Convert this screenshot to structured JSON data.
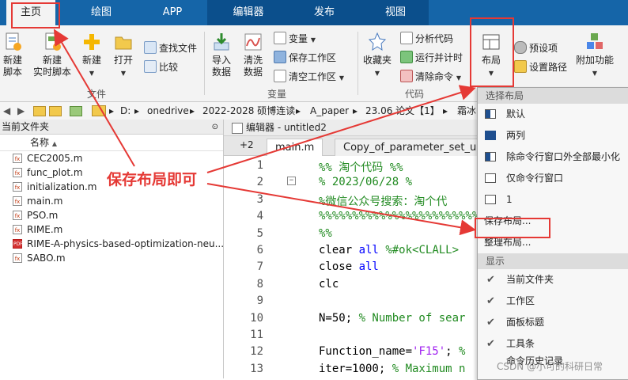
{
  "tabs": [
    "主页",
    "绘图",
    "APP",
    "编辑器",
    "发布",
    "视图"
  ],
  "ribbon": {
    "new_script": "新建\n脚本",
    "new_live_script": "新建\n实时脚本",
    "new": "新建",
    "open": "打开",
    "find_files": "查找文件",
    "compare": "比较",
    "import_data": "导入\n数据",
    "clean_data": "清洗\n数据",
    "variable": "变量",
    "save_workspace": "保存工作区",
    "clear_workspace": "清空工作区",
    "favorites": "收藏夹",
    "analyze_code": "分析代码",
    "run_and_time": "运行并计时",
    "clear_commands": "清除命令",
    "layout": "布局",
    "preferences": "预设项",
    "set_path": "设置路径",
    "addons": "附加功能",
    "section_file": "文件",
    "section_variable": "变量",
    "section_code": "代码"
  },
  "address": {
    "path": [
      "D:",
      "onedrive",
      "2022-2028 硕博连读",
      "A_paper",
      "23.06 论文【1】",
      "霜冰"
    ]
  },
  "file_panel": {
    "title": "当前文件夹",
    "column_name": "名称",
    "files": [
      {
        "name": "CEC2005.m",
        "type": "m"
      },
      {
        "name": "func_plot.m",
        "type": "m"
      },
      {
        "name": "initialization.m",
        "type": "m"
      },
      {
        "name": "main.m",
        "type": "m"
      },
      {
        "name": "PSO.m",
        "type": "m"
      },
      {
        "name": "RIME.m",
        "type": "m"
      },
      {
        "name": "RIME-A-physics-based-optimization-neu...",
        "type": "pdf"
      },
      {
        "name": "SABO.m",
        "type": "m"
      }
    ]
  },
  "editor": {
    "title": "编辑器 - untitled2",
    "tab_count": "+2",
    "tabs": [
      "main.m",
      "Copy_of_parameter_set_up"
    ],
    "line_numbers": [
      "1",
      "2",
      "3",
      "4",
      "5",
      "6",
      "7",
      "8",
      "9",
      "10",
      "11",
      "12",
      "13"
    ]
  },
  "layout_menu": {
    "header_select": "选择布局",
    "items": [
      "默认",
      "两列",
      "除命令行窗口外全部最小化",
      "仅命令行窗口",
      "1"
    ],
    "save_layout": "保存布局...",
    "organize_layout": "整理布局...",
    "header_show": "显示",
    "show_items": [
      "当前文件夹",
      "工作区",
      "面板标题",
      "工具条",
      "命令历史记录"
    ]
  },
  "annotation": {
    "text": "保存布局即可",
    "color": "#e53935"
  },
  "watermark": "CSDN @小可的科研日常",
  "colors": {
    "tab_bar": "#1565a8",
    "editor_group": "#0b4f8c",
    "comment": "#228b22",
    "keyword": "#0000ff",
    "string": "#a020f0"
  }
}
